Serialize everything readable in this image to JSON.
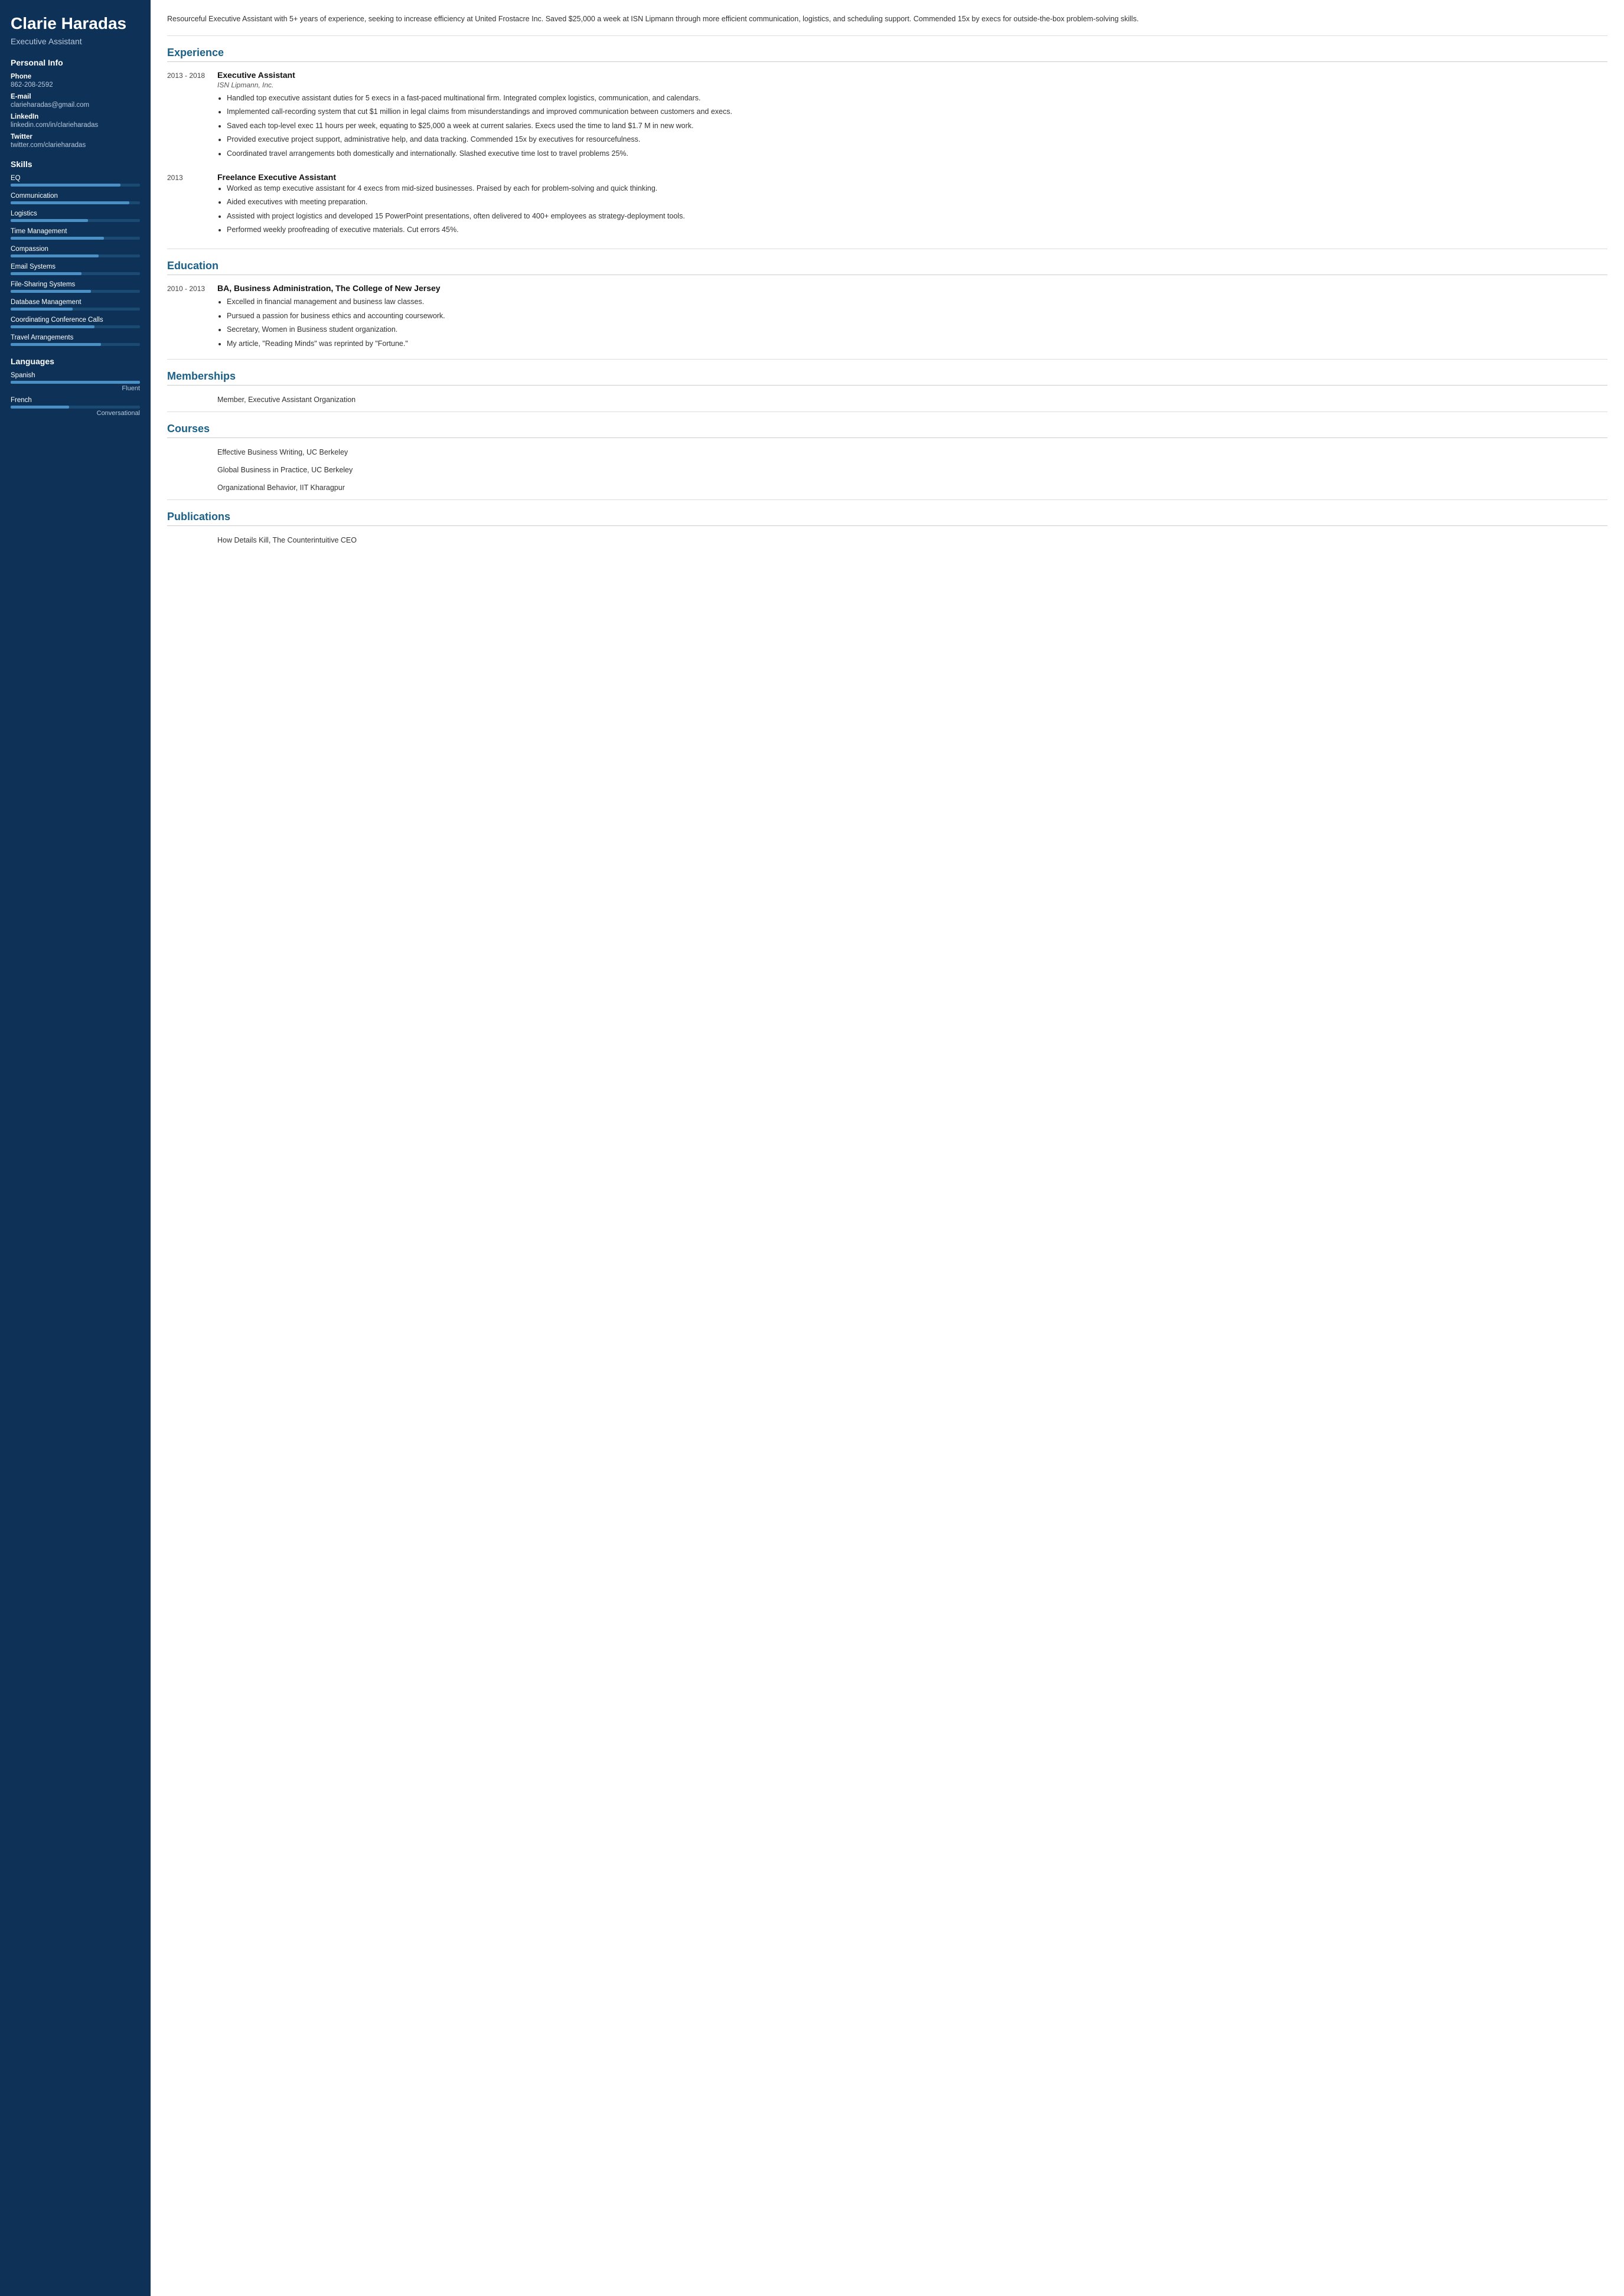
{
  "sidebar": {
    "name": "Clarie Haradas",
    "title": "Executive Assistant",
    "personal_info": {
      "section_label": "Personal Info",
      "phone_label": "Phone",
      "phone": "862-208-2592",
      "email_label": "E-mail",
      "email": "clarieharadas@gmail.com",
      "linkedin_label": "LinkedIn",
      "linkedin": "linkedin.com/in/clarieharadas",
      "twitter_label": "Twitter",
      "twitter": "twitter.com/clarieharadas"
    },
    "skills_label": "Skills",
    "skills": [
      {
        "name": "EQ",
        "pct": 85
      },
      {
        "name": "Communication",
        "pct": 92
      },
      {
        "name": "Logistics",
        "pct": 60
      },
      {
        "name": "Time Management",
        "pct": 72
      },
      {
        "name": "Compassion",
        "pct": 68
      },
      {
        "name": "Email Systems",
        "pct": 55
      },
      {
        "name": "File-Sharing Systems",
        "pct": 62
      },
      {
        "name": "Database Management",
        "pct": 48
      },
      {
        "name": "Coordinating Conference Calls",
        "pct": 65
      },
      {
        "name": "Travel Arrangements",
        "pct": 70
      }
    ],
    "languages_label": "Languages",
    "languages": [
      {
        "name": "Spanish",
        "pct": 100,
        "level": "Fluent"
      },
      {
        "name": "French",
        "pct": 45,
        "level": "Conversational"
      }
    ]
  },
  "main": {
    "summary": "Resourceful Executive Assistant with 5+ years of experience, seeking to increase efficiency at United Frostacre Inc. Saved $25,000 a week at ISN Lipmann through more efficient communication, logistics, and scheduling support. Commended 15x by execs for outside-the-box problem-solving skills.",
    "experience_label": "Experience",
    "jobs": [
      {
        "dates": "2013 - 2018",
        "title": "Executive Assistant",
        "company": "ISN Lipmann, Inc.",
        "bullets": [
          "Handled top executive assistant duties for 5 execs in a fast-paced multinational firm. Integrated complex logistics, communication, and calendars.",
          "Implemented call-recording system that cut $1 million in legal claims from misunderstandings and improved communication between customers and execs.",
          "Saved each top-level exec 11 hours per week, equating to $25,000 a week at current salaries. Execs used the time to land $1.7 M in new work.",
          "Provided executive project support, administrative help, and data tracking. Commended 15x by executives for resourcefulness.",
          "Coordinated travel arrangements both domestically and internationally. Slashed executive time lost to travel problems 25%."
        ]
      },
      {
        "dates": "2013",
        "title": "Freelance Executive Assistant",
        "company": "",
        "bullets": [
          "Worked as temp executive assistant for 4 execs from mid-sized businesses. Praised by each for problem-solving and quick thinking.",
          "Aided executives with meeting preparation.",
          "Assisted with project logistics and developed 15 PowerPoint presentations, often delivered to 400+ employees as strategy-deployment tools.",
          "Performed weekly proofreading of executive materials. Cut errors 45%."
        ]
      }
    ],
    "education_label": "Education",
    "education": [
      {
        "dates": "2010 - 2013",
        "degree": "BA, Business Administration, The College of New Jersey",
        "bullets": [
          "Excelled in financial management and business law classes.",
          "Pursued a passion for business ethics and accounting coursework.",
          "Secretary, Women in Business student organization.",
          "My article, \"Reading Minds\" was reprinted by \"Fortune.\""
        ]
      }
    ],
    "memberships_label": "Memberships",
    "memberships": [
      "Member, Executive Assistant Organization"
    ],
    "courses_label": "Courses",
    "courses": [
      "Effective Business Writing, UC Berkeley",
      "Global Business in Practice, UC Berkeley",
      "Organizational Behavior, IIT Kharagpur"
    ],
    "publications_label": "Publications",
    "publications": [
      "How Details Kill, The Counterintuitive CEO"
    ]
  }
}
